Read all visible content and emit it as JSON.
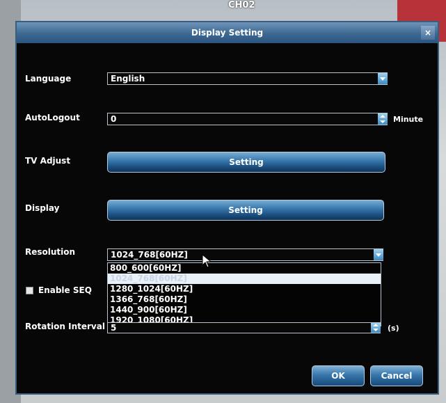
{
  "camera": {
    "channel_label": "CH02"
  },
  "dialog": {
    "title": "Display Setting",
    "close_glyph": "×"
  },
  "language": {
    "label": "Language",
    "value": "English"
  },
  "auto_logout": {
    "label": "AutoLogout",
    "value": "0",
    "unit": "Minute"
  },
  "tv_adjust": {
    "label": "TV Adjust",
    "button": "Setting"
  },
  "display": {
    "label": "Display",
    "button": "Setting"
  },
  "resolution": {
    "label": "Resolution",
    "value": "1024_768[60HZ]",
    "options": [
      {
        "label": "800_600[60HZ]",
        "selected": false
      },
      {
        "label": "1024_768[60HZ]",
        "selected": true
      },
      {
        "label": "1280_1024[60HZ]",
        "selected": false
      },
      {
        "label": "1366_768[60HZ]",
        "selected": false
      },
      {
        "label": "1440_900[60HZ]",
        "selected": false
      },
      {
        "label": "1920_1080[60HZ]",
        "selected": false
      }
    ]
  },
  "enable_seq": {
    "label": "Enable SEQ",
    "checked": true
  },
  "rotation_interval": {
    "label": "Rotation Interval",
    "value": "5",
    "unit": "(s)"
  },
  "buttons": {
    "ok": "OK",
    "cancel": "Cancel"
  },
  "icons": {
    "cursor": "mouse-pointer-icon",
    "close": "close-icon"
  },
  "colors": {
    "title_bar": "#3d6892",
    "dialog_bg": "#070707",
    "button_blue": "#3b7bb0"
  }
}
